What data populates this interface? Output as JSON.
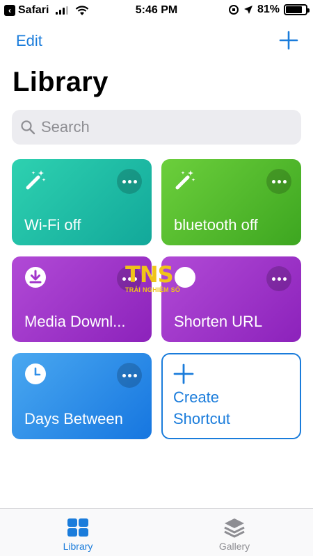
{
  "status_bar": {
    "back_app": "Safari",
    "time": "5:46 PM",
    "battery": "81%",
    "battery_level": 0.81
  },
  "nav": {
    "edit_label": "Edit"
  },
  "page_title": "Library",
  "search": {
    "placeholder": "Search"
  },
  "shortcuts": [
    {
      "label": "Wi-Fi off",
      "icon": "magic-wand-icon",
      "color": "#1fbca5"
    },
    {
      "label": "bluetooth off",
      "icon": "magic-wand-icon",
      "color": "#52bb2e"
    },
    {
      "label": "Media Downl...",
      "icon": "download-icon",
      "color": "#a236cb"
    },
    {
      "label": "Shorten URL",
      "icon": "unknown-icon",
      "color": "#a236cb"
    },
    {
      "label": "Days Between",
      "icon": "clock-icon",
      "color": "#2e8ee8"
    }
  ],
  "create_shortcut": {
    "line1": "Create",
    "line2": "Shortcut"
  },
  "watermark": {
    "main": "TNS",
    "sub": "TRẢI NGHIỆM SỐ"
  },
  "tabs": [
    {
      "label": "Library",
      "active": true
    },
    {
      "label": "Gallery",
      "active": false
    }
  ],
  "colors": {
    "accent": "#1a7cdb",
    "search_bg": "#ececf0"
  }
}
